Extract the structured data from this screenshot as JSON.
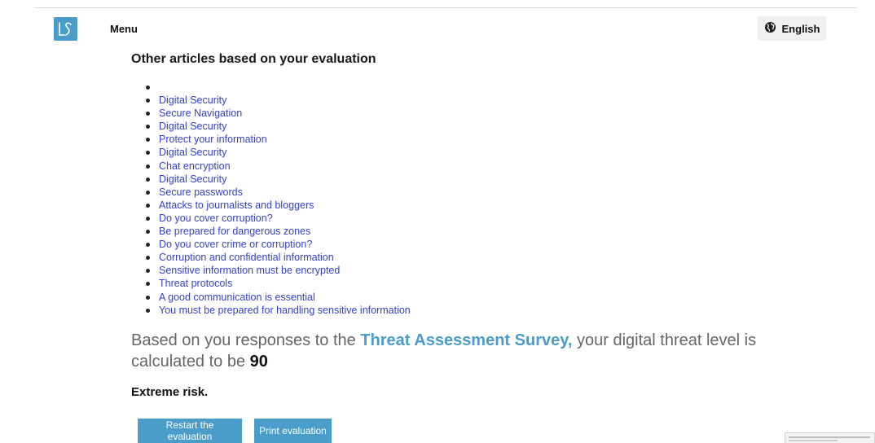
{
  "header": {
    "menu_label": "Menu",
    "language_label": "English",
    "logo_icon": "ls-logo-icon",
    "globe_icon": "globe-icon"
  },
  "articles": {
    "title": "Other articles based on your evaluation",
    "items": [
      "",
      "Digital Security",
      "Secure Navigation",
      "Digital Security",
      "Protect your information",
      "Digital Security",
      "Chat encryption",
      "Digital Security",
      "Secure passwords",
      "Attacks to journalists and bloggers",
      "Do you cover corruption?",
      "Be prepared for dangerous zones",
      "Do you cover crime or corruption?",
      "Corruption and confidential information",
      "Sensitive information must be encrypted",
      "Threat protocols",
      "A good communication is essential",
      "You must be prepared for handling sensitive information"
    ]
  },
  "result": {
    "text_before": "Based on you responses to the ",
    "survey_link": "Threat Assessment Survey,",
    "text_after": " your digital threat level is calculated to be ",
    "score": "90",
    "risk_label": "Extreme risk."
  },
  "actions": {
    "restart_label": "Restart the evaluation",
    "print_label": "Print evaluation"
  },
  "colors": {
    "accent": "#4a9cc9",
    "link": "#3340d6",
    "muted_text": "#666666"
  }
}
